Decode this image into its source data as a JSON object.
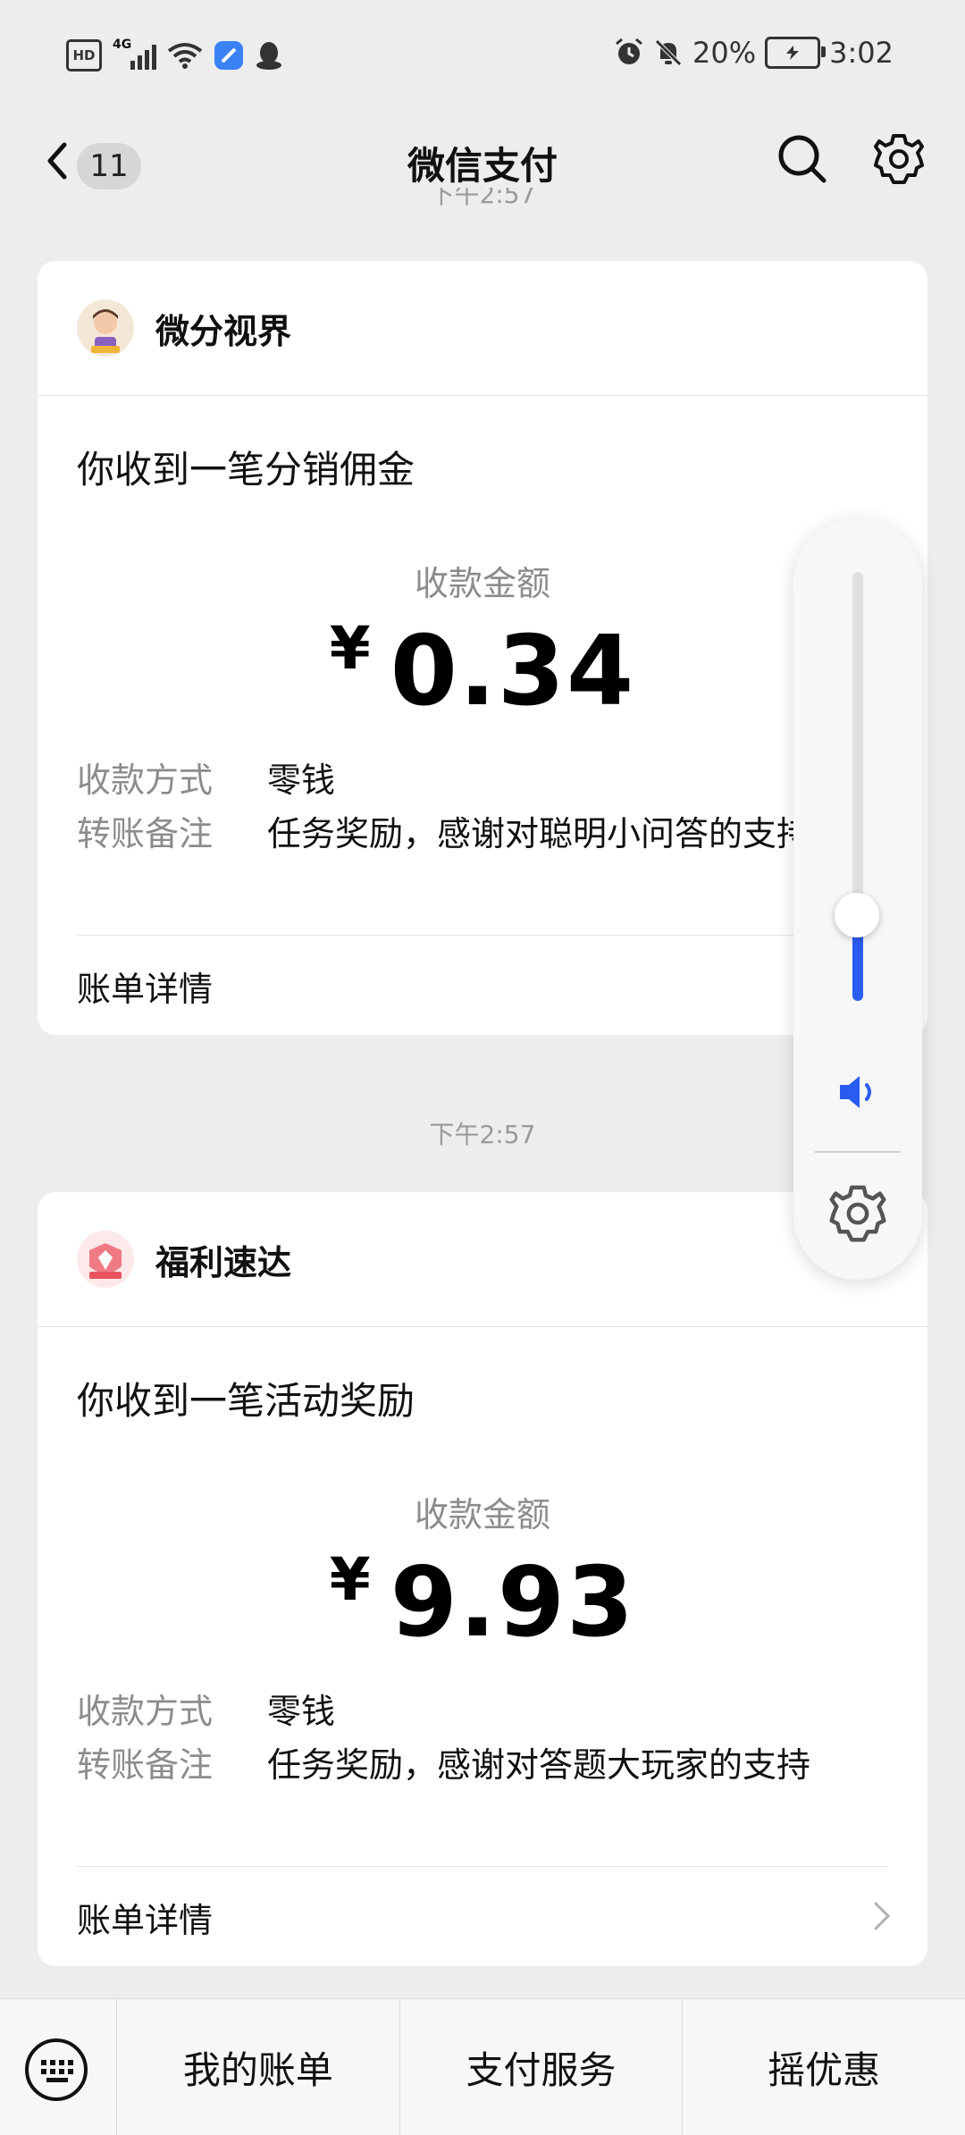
{
  "status_bar": {
    "hd": "HD",
    "network": "4G",
    "battery": "20%",
    "time": "3:02"
  },
  "header": {
    "badge_count": "11",
    "title": "微信支付"
  },
  "top_time_partial": "下午2:57",
  "cards": [
    {
      "merchant": "微分视界",
      "title": "你收到一笔分销佣金",
      "amount_label": "收款金额",
      "currency": "¥",
      "amount": "0.34",
      "method_key": "收款方式",
      "method_value": "零钱",
      "note_key": "转账备注",
      "note_value": "任务奖励，感谢对聪明小问答的支持",
      "detail_label": "账单详情"
    },
    {
      "time_label": "下午2:57",
      "merchant": "福利速达",
      "title": "你收到一笔活动奖励",
      "amount_label": "收款金额",
      "currency": "¥",
      "amount": "9.93",
      "method_key": "收款方式",
      "method_value": "零钱",
      "note_key": "转账备注",
      "note_value": "任务奖励，感谢对答题大玩家的支持",
      "detail_label": "账单详情"
    }
  ],
  "bottom_tabs": [
    "我的账单",
    "支付服务",
    "摇优惠"
  ],
  "volume_level": 0.2,
  "colors": {
    "accent": "#2b5cf0",
    "background": "#ededed",
    "card": "#ffffff"
  },
  "icons": [
    "back-arrow-icon",
    "search-icon",
    "gear-icon",
    "chevron-right-icon",
    "keyboard-icon",
    "speaker-icon",
    "wifi-icon",
    "alarm-icon",
    "mute-bell-icon",
    "qq-icon"
  ]
}
